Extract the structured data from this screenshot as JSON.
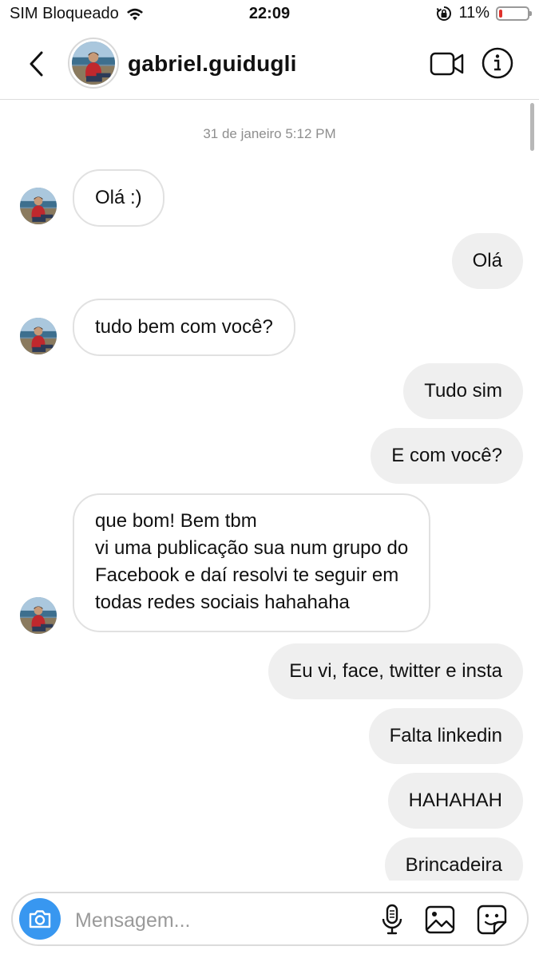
{
  "status_bar": {
    "carrier": "SIM Bloqueado",
    "time": "22:09",
    "battery": "11%",
    "battery_level": 0.11
  },
  "header": {
    "username": "gabriel.guidugli",
    "back_icon": "chevron-left-icon",
    "video_icon": "video-camera-icon",
    "info_icon": "info-icon"
  },
  "chat": {
    "timestamp": "31 de janeiro 5:12 PM",
    "messages": [
      {
        "from": "them",
        "lines": [
          "Olá :)"
        ]
      },
      {
        "from": "me",
        "lines": [
          "Olá"
        ]
      },
      {
        "from": "them",
        "lines": [
          "tudo bem com você?"
        ]
      },
      {
        "from": "me",
        "lines": [
          "Tudo sim"
        ]
      },
      {
        "from": "me",
        "lines": [
          "E com você?"
        ]
      },
      {
        "from": "them",
        "lines": [
          "que bom! Bem tbm",
          "vi uma publicação sua num grupo do",
          "Facebook e daí resolvi te seguir em",
          "todas redes sociais hahahaha"
        ]
      },
      {
        "from": "me",
        "lines": [
          "Eu vi, face, twitter e insta"
        ]
      },
      {
        "from": "me",
        "lines": [
          "Falta linkedin"
        ]
      },
      {
        "from": "me",
        "lines": [
          "HAHAHAH"
        ]
      },
      {
        "from": "me",
        "lines": [
          "Brincadeira"
        ]
      }
    ]
  },
  "composer": {
    "placeholder": "Mensagem...",
    "camera_icon": "camera-icon",
    "mic_icon": "microphone-icon",
    "gallery_icon": "gallery-icon",
    "sticker_icon": "sticker-icon"
  },
  "colors": {
    "accent": "#3897f0",
    "outgoing_bubble": "#efefef",
    "incoming_border": "#e1e1e1",
    "battery_low": "#e0312b"
  }
}
